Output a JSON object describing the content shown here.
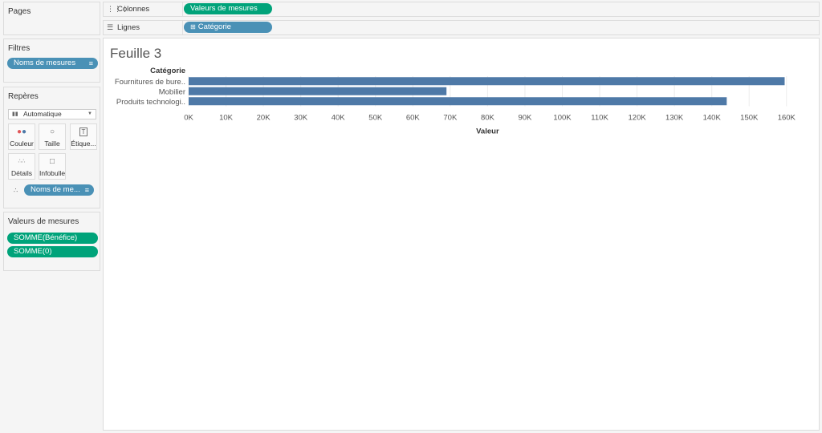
{
  "pages": {
    "title": "Pages"
  },
  "filters": {
    "title": "Filtres",
    "pill": "Noms de mesures"
  },
  "marks": {
    "title": "Repères",
    "mark_type": "Automatique",
    "buttons": {
      "color": "Couleur",
      "size": "Taille",
      "label": "Étique...",
      "detail": "Détails",
      "tooltip": "Infobulle"
    },
    "detail_pill": "Noms de me..."
  },
  "measure_values": {
    "title": "Valeurs de mesures",
    "items": [
      "SOMME(Bénéfice)",
      "SOMME(0)"
    ]
  },
  "shelves": {
    "columns_label": "Colonnes",
    "columns_pill": "Valeurs de mesures",
    "rows_label": "Lignes",
    "rows_pill": "Catégorie"
  },
  "sheet": {
    "title": "Feuille 3"
  },
  "chart_data": {
    "type": "bar",
    "orientation": "horizontal",
    "row_header": "Catégorie",
    "categories": [
      "Fournitures de bure..",
      "Mobilier",
      "Produits technologi.."
    ],
    "values": [
      159500,
      69000,
      144000
    ],
    "xlabel": "Valeur",
    "xlim": [
      0,
      165000
    ],
    "ticks": [
      0,
      10000,
      20000,
      30000,
      40000,
      50000,
      60000,
      70000,
      80000,
      90000,
      100000,
      110000,
      120000,
      130000,
      140000,
      150000,
      160000
    ],
    "tick_labels": [
      "0K",
      "10K",
      "20K",
      "30K",
      "40K",
      "50K",
      "60K",
      "70K",
      "80K",
      "90K",
      "100K",
      "110K",
      "120K",
      "130K",
      "140K",
      "150K",
      "160K"
    ],
    "bar_color": "#4e79a7",
    "grid": true
  }
}
